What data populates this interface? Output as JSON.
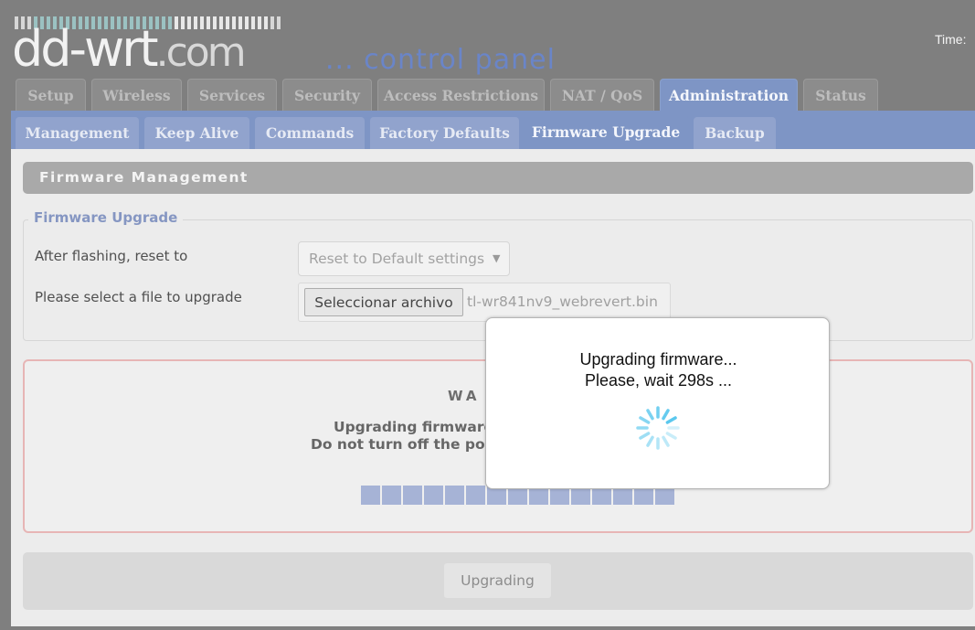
{
  "header": {
    "logo_main": "dd-wrt",
    "logo_suffix": ".com",
    "subtitle": "... control panel",
    "time_label": "Time:"
  },
  "main_tabs": [
    {
      "label": "Setup"
    },
    {
      "label": "Wireless"
    },
    {
      "label": "Services"
    },
    {
      "label": "Security"
    },
    {
      "label": "Access Restrictions"
    },
    {
      "label": "NAT / QoS"
    },
    {
      "label": "Administration",
      "active": true
    },
    {
      "label": "Status"
    }
  ],
  "sub_tabs": [
    {
      "label": "Management"
    },
    {
      "label": "Keep Alive"
    },
    {
      "label": "Commands"
    },
    {
      "label": "Factory Defaults"
    },
    {
      "label": "Firmware Upgrade",
      "active": true
    },
    {
      "label": "Backup"
    }
  ],
  "section": {
    "title": "Firmware Management",
    "legend": "Firmware Upgrade",
    "reset_label": "After flashing, reset to",
    "reset_value": "Reset to Default settings",
    "file_label": "Please select a file to upgrade",
    "file_button": "Seleccionar archivo",
    "file_name": "tl-wr841nv9_webrevert.bin"
  },
  "warning": {
    "title": "WA",
    "line1": "Upgrading firmware",
    "line2": "Do not turn off the powe",
    "progress_blocks_filled": 15
  },
  "bottom": {
    "button_label": "Upgrading"
  },
  "dialog": {
    "line1": "Upgrading firmware...",
    "line2": "Please, wait 298s ..."
  },
  "colors": {
    "background": "#7f7f7f",
    "active_tab": "#7e95c5",
    "subtitle_blue": "#6a85c8",
    "progress_block": "#a6b3d6",
    "warning_border": "#e7b5b5",
    "spinner": "#5bc8ee"
  }
}
